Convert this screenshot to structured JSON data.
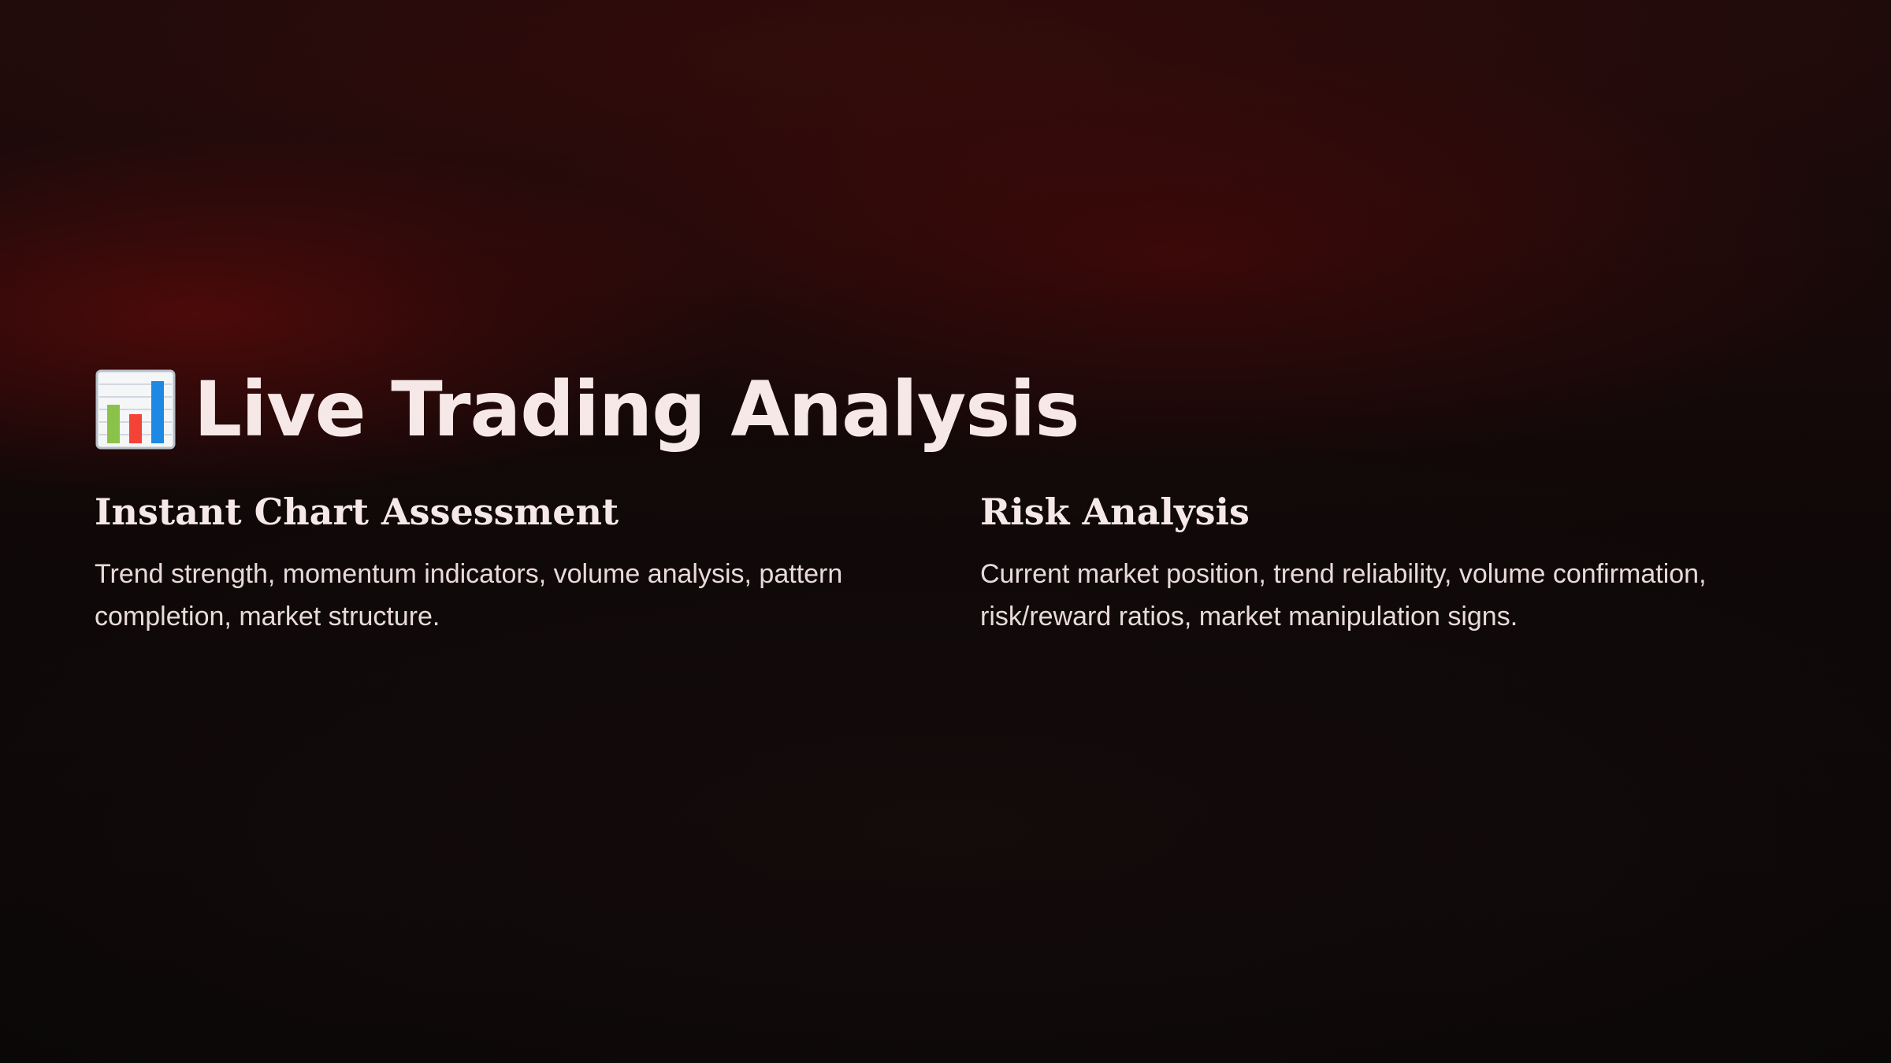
{
  "slide": {
    "title_icon": "bar-chart-emoji-icon",
    "title": "Live Trading Analysis",
    "columns": [
      {
        "heading": "Instant Chart Assessment",
        "body": "Trend strength, momentum indicators, volume analysis, pattern completion, market structure."
      },
      {
        "heading": "Risk Analysis",
        "body": "Current market position, trend reliability, volume confirmation, risk/reward ratios, market manipulation signs."
      }
    ]
  },
  "colors": {
    "text": "#f7e8e8",
    "background": "#0a0707",
    "glow": "#7a0a0a"
  }
}
